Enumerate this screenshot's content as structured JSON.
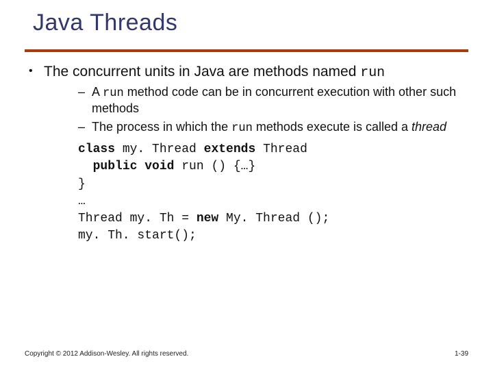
{
  "title": "Java Threads",
  "bullet1_a": "The concurrent units in Java are methods named ",
  "bullet1_b": "run",
  "sub1_a": "A ",
  "sub1_b": "run",
  "sub1_c": " method code can be in concurrent execution with other such methods",
  "sub2_a": "The process in which the ",
  "sub2_b": "run",
  "sub2_c": " methods execute is called a ",
  "sub2_d": "thread",
  "code": {
    "l1a": "class",
    "l1b": " my. Thread ",
    "l1c": "extends",
    "l1d": " Thread",
    "l2a": "  ",
    "l2b": "public void",
    "l2c": " run () {…}",
    "l3": "}",
    "l4": "…",
    "l5a": "Thread my. Th = ",
    "l5b": "new",
    "l5c": " My. Thread ();",
    "l6": "my. Th. start();"
  },
  "footer": "Copyright © 2012 Addison-Wesley. All rights reserved.",
  "pagenum": "1-39"
}
